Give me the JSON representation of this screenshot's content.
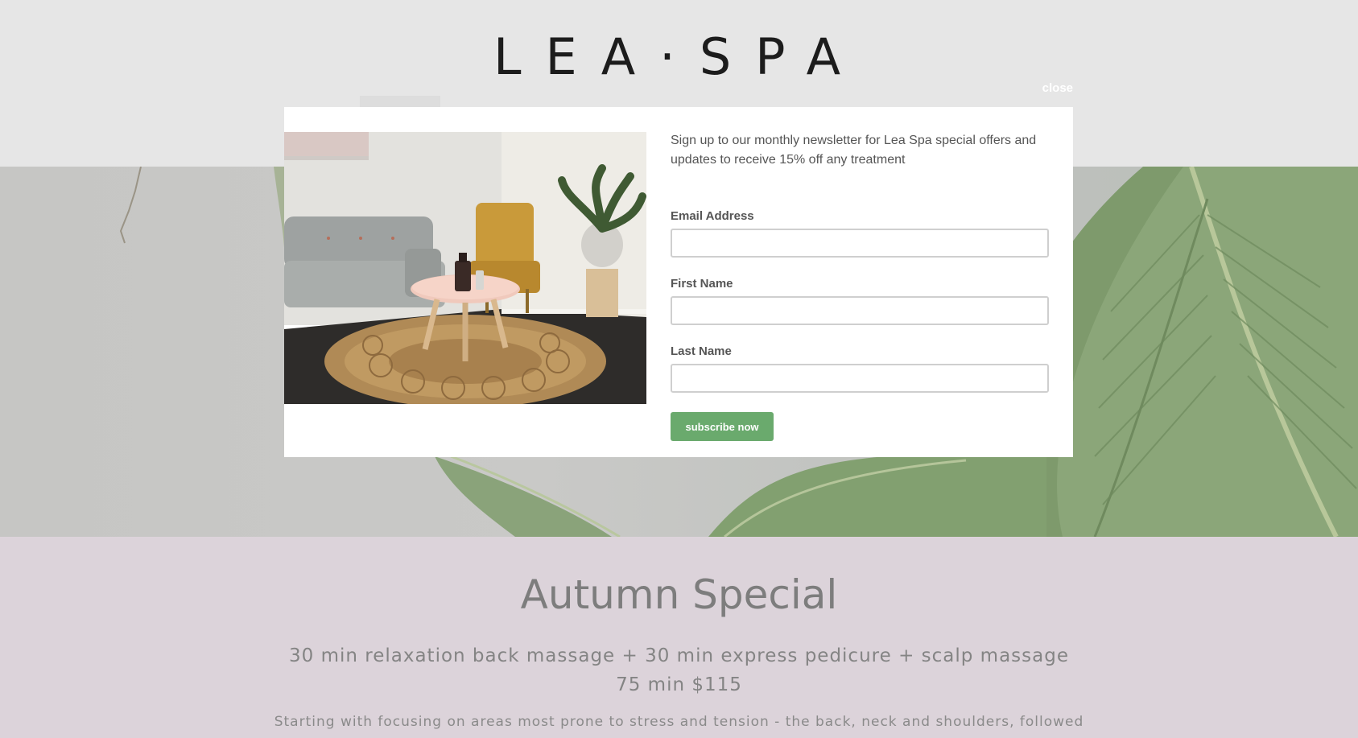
{
  "header": {
    "logo_text": "LEA·SPA",
    "close_label": "close"
  },
  "modal": {
    "intro": "Sign up to our monthly newsletter for Lea Spa special offers and updates to receive 15% off any treatment",
    "fields": [
      {
        "label": "Email Address",
        "value": ""
      },
      {
        "label": "First Name",
        "value": ""
      },
      {
        "label": "Last Name",
        "value": ""
      }
    ],
    "submit_label": "subscribe now",
    "accent_color": "#6aaa6d"
  },
  "special": {
    "title": "Autumn Special",
    "subtitle": "30 min relaxation back massage + 30 min express pedicure + scalp massage",
    "price": "75 min $115",
    "description": "Starting with focusing on areas most prone to stress and tension - the back, neck and shoulders, followed"
  }
}
